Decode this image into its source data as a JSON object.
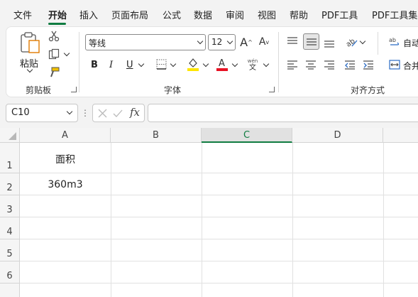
{
  "menu": {
    "items": [
      "文件",
      "开始",
      "插入",
      "页面布局",
      "公式",
      "数据",
      "审阅",
      "视图",
      "帮助",
      "PDF工具",
      "PDF工具集"
    ],
    "active": "开始"
  },
  "ribbon": {
    "clipboard": {
      "paste_label": "粘贴",
      "group_label": "剪贴板"
    },
    "font": {
      "font_name": "等线",
      "font_size": "12",
      "phonetic_top": "wén",
      "phonetic_bottom": "文",
      "group_label": "字体",
      "bold": "B",
      "italic": "I",
      "underline": "U"
    },
    "alignment": {
      "group_label": "对齐方式",
      "wrap_label": "自动",
      "merge_label": "合并"
    }
  },
  "formula_bar": {
    "name_box": "C10",
    "fx_label": "fx",
    "formula": ""
  },
  "grid": {
    "columns": [
      "A",
      "B",
      "C",
      "D"
    ],
    "selected_column": "C",
    "rows": [
      "1",
      "2",
      "3",
      "4",
      "5",
      "6"
    ],
    "cells": {
      "A1": "面积",
      "A2": "360m3"
    }
  },
  "colors": {
    "accent": "#107c41",
    "font_color": "#e81123",
    "fill_color": "#ffe600"
  }
}
